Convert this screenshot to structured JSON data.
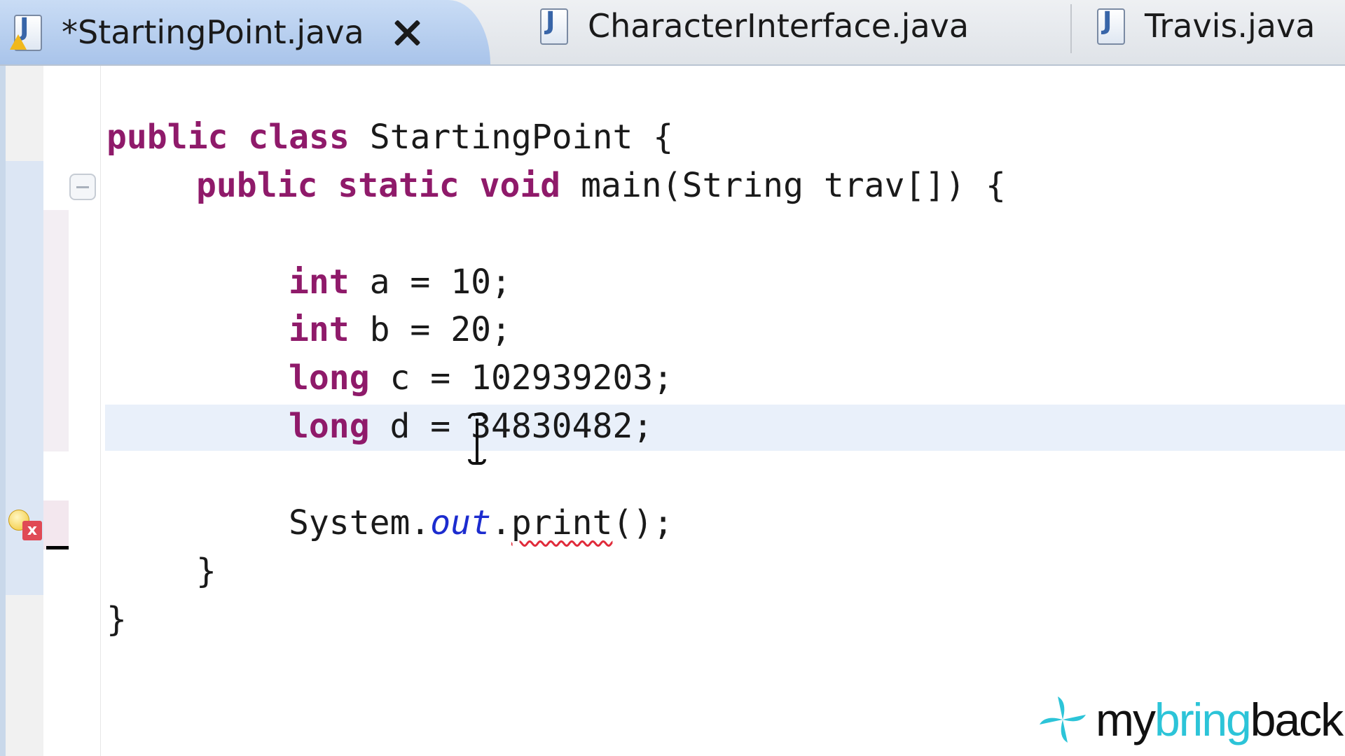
{
  "tabs": [
    {
      "label": "*StartingPoint.java",
      "active": true,
      "dirty": true,
      "icon": "java-file-icon"
    },
    {
      "label": "CharacterInterface.java",
      "active": false,
      "icon": "java-file-icon"
    },
    {
      "label": "Travis.java",
      "active": false,
      "icon": "java-file-icon"
    }
  ],
  "tab_icon_letter": "J",
  "editor": {
    "lines": {
      "l1": {
        "kw1": "public",
        "kw2": "class",
        "rest": " StartingPoint {"
      },
      "l2": {
        "kw1": "public",
        "kw2": "static",
        "kw3": "void",
        "rest": " main(String trav[]) {"
      },
      "l3": {
        "kw": "int",
        "rest": " a = 10;"
      },
      "l4": {
        "kw": "int",
        "rest": " b = 20;"
      },
      "l5": {
        "kw": "long",
        "rest": " c = 102939203;"
      },
      "l6": {
        "kw": "long",
        "rest": " d = 34830482;"
      },
      "l7": {
        "obj": "System.",
        "field": "out",
        "dot": ".",
        "method": "print",
        "rest": "();"
      },
      "l8": {
        "text": "}"
      },
      "l9": {
        "text": "}"
      }
    },
    "error_marker_letter": "x",
    "colors": {
      "keyword": "#8f1a6a",
      "static_field": "#1c2ccf",
      "error_underline": "#e02b3a",
      "current_line": "#e9f0fa"
    }
  },
  "watermark": {
    "part1": "my",
    "part2": "bring",
    "part3": "back",
    "accent": "#2cc4d8"
  }
}
